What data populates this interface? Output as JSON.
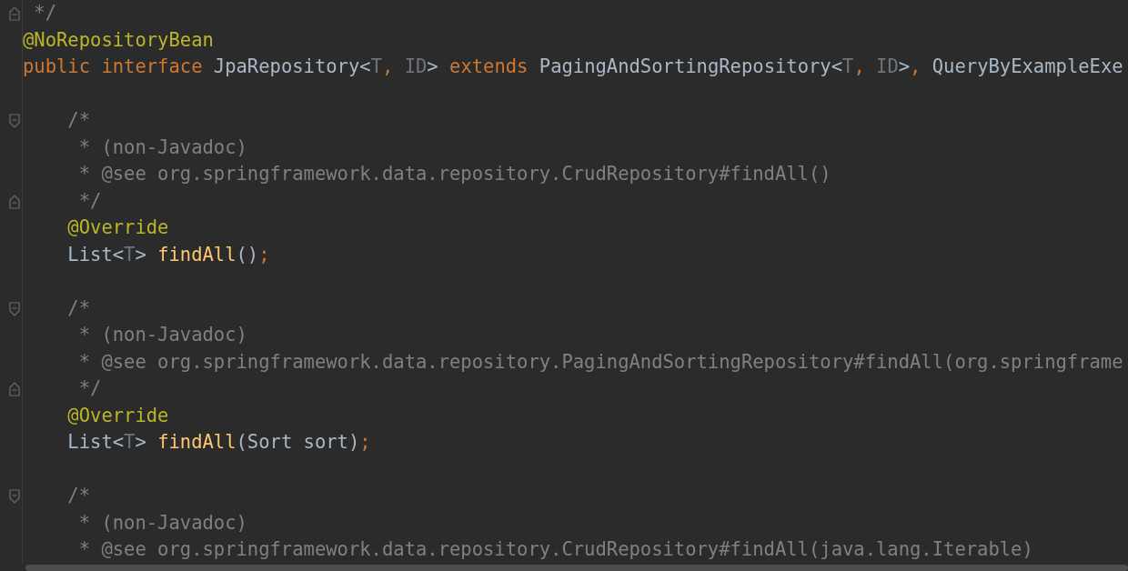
{
  "editor": {
    "lines": [
      {
        "kind": "fold_end",
        "tokens": [
          {
            "text": " */",
            "kind": "comment"
          }
        ]
      },
      {
        "kind": "code",
        "tokens": [
          {
            "text": "@NoRepositoryBean",
            "kind": "annotation"
          }
        ]
      },
      {
        "kind": "code",
        "tokens": [
          {
            "text": "public ",
            "kind": "keyword"
          },
          {
            "text": "interface",
            "kind": "keyword"
          },
          {
            "text": " JpaRepository<",
            "kind": "plain"
          },
          {
            "text": "T",
            "kind": "typeparam"
          },
          {
            "text": ", ",
            "kind": "punct"
          },
          {
            "text": "ID",
            "kind": "typeparam"
          },
          {
            "text": "> ",
            "kind": "plain"
          },
          {
            "text": "extends",
            "kind": "keyword"
          },
          {
            "text": " PagingAndSortingRepository<",
            "kind": "plain"
          },
          {
            "text": "T",
            "kind": "typeparam"
          },
          {
            "text": ", ",
            "kind": "punct"
          },
          {
            "text": "ID",
            "kind": "typeparam"
          },
          {
            "text": ">",
            "kind": "plain"
          },
          {
            "text": ", ",
            "kind": "punct"
          },
          {
            "text": "QueryByExampleExe",
            "kind": "plain"
          }
        ]
      },
      {
        "kind": "blank"
      },
      {
        "kind": "fold_start",
        "tokens": [
          {
            "text": "    /*",
            "kind": "comment"
          }
        ]
      },
      {
        "kind": "code",
        "tokens": [
          {
            "text": "     * (non-Javadoc)",
            "kind": "comment"
          }
        ]
      },
      {
        "kind": "code",
        "tokens": [
          {
            "text": "     * @see org.springframework.data.repository.CrudRepository#findAll()",
            "kind": "comment"
          }
        ]
      },
      {
        "kind": "fold_end",
        "tokens": [
          {
            "text": "     */",
            "kind": "comment"
          }
        ]
      },
      {
        "kind": "code",
        "tokens": [
          {
            "text": "    @Override",
            "kind": "annotation"
          }
        ]
      },
      {
        "kind": "code",
        "tokens": [
          {
            "text": "    List<",
            "kind": "plain"
          },
          {
            "text": "T",
            "kind": "typeparam"
          },
          {
            "text": "> ",
            "kind": "plain"
          },
          {
            "text": "findAll",
            "kind": "method"
          },
          {
            "text": "()",
            "kind": "plain"
          },
          {
            "text": ";",
            "kind": "punct"
          }
        ]
      },
      {
        "kind": "blank"
      },
      {
        "kind": "fold_start",
        "tokens": [
          {
            "text": "    /*",
            "kind": "comment"
          }
        ]
      },
      {
        "kind": "code",
        "tokens": [
          {
            "text": "     * (non-Javadoc)",
            "kind": "comment"
          }
        ]
      },
      {
        "kind": "code",
        "tokens": [
          {
            "text": "     * @see org.springframework.data.repository.PagingAndSortingRepository#findAll(org.springframe",
            "kind": "comment"
          }
        ]
      },
      {
        "kind": "fold_end",
        "tokens": [
          {
            "text": "     */",
            "kind": "comment"
          }
        ]
      },
      {
        "kind": "code",
        "tokens": [
          {
            "text": "    @Override",
            "kind": "annotation"
          }
        ]
      },
      {
        "kind": "code",
        "tokens": [
          {
            "text": "    List<",
            "kind": "plain"
          },
          {
            "text": "T",
            "kind": "typeparam"
          },
          {
            "text": "> ",
            "kind": "plain"
          },
          {
            "text": "findAll",
            "kind": "method"
          },
          {
            "text": "(Sort sort)",
            "kind": "plain"
          },
          {
            "text": ";",
            "kind": "punct"
          }
        ]
      },
      {
        "kind": "blank"
      },
      {
        "kind": "fold_start",
        "tokens": [
          {
            "text": "    /*",
            "kind": "comment"
          }
        ]
      },
      {
        "kind": "code",
        "tokens": [
          {
            "text": "     * (non-Javadoc)",
            "kind": "comment"
          }
        ]
      },
      {
        "kind": "code",
        "tokens": [
          {
            "text": "     * @see org.springframework.data.repository.CrudRepository#findAll(java.lang.Iterable)",
            "kind": "comment"
          }
        ]
      }
    ]
  }
}
